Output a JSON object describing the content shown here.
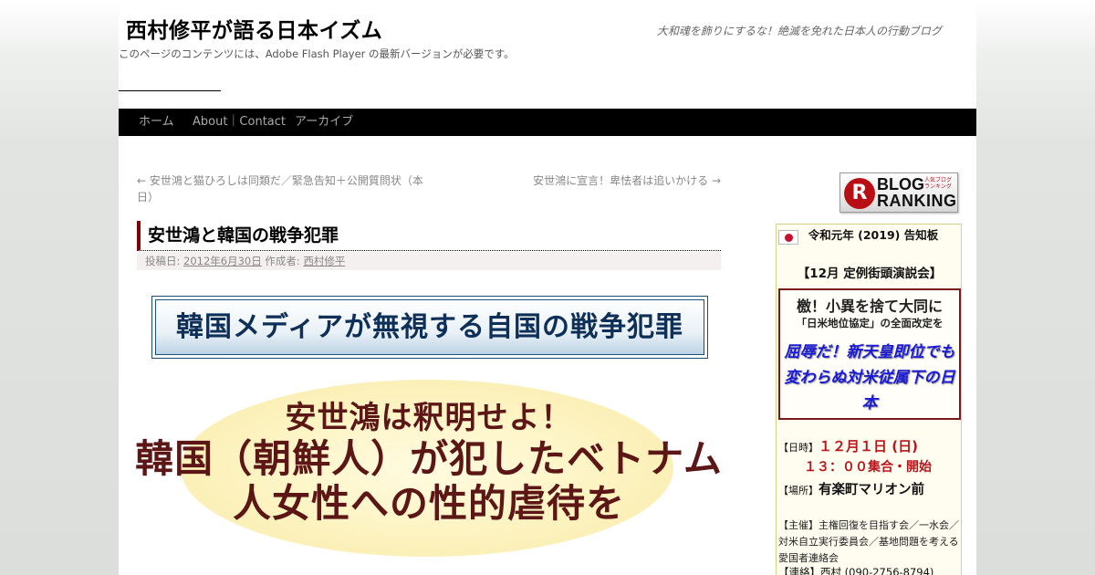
{
  "site": {
    "title": "西村修平が語る日本イズム",
    "description": "大和魂を飾りにするな！絶滅を免れた日本人の行動ブログ",
    "flash_notice": "このページのコンテンツには、Adobe Flash Player の最新バージョンが必要です。"
  },
  "menu": {
    "items": [
      {
        "label": "ホーム"
      },
      {
        "label": "About｜Contact"
      },
      {
        "label": "アーカイブ"
      }
    ]
  },
  "post_nav": {
    "prev": "← 安世鴻と猫ひろしは同類だ／緊急告知＋公開質問状（本日）",
    "next": "安世鴻に宣言！卑怯者は追いかける →"
  },
  "entry": {
    "title": "安世鴻と韓国の戦争犯罪",
    "meta_posted_prefix": "投稿日:",
    "meta_date": "2012年6月30日",
    "meta_author_prefix": "作成者:",
    "meta_author": "西村修平",
    "headline": "韓国メディアが無視する自国の戦争犯罪",
    "demand_line_1": "安世鴻は釈明せよ！",
    "demand_line_2": "韓国（朝鮮人）が犯したベトナム人女性への性的虐待を"
  },
  "sidebar": {
    "ranking_badge": {
      "letter": "R",
      "blog": "BLOG",
      "small": "人気ブログランキング",
      "ranking": "RANKING"
    },
    "notice": {
      "title": "令和元年 (2019) 告知板",
      "speech_title": "【12月 定例街頭演説会】",
      "slogan_1": "檄！小異を捨て大同に",
      "slogan_2": "「日米地位協定」の全面改定を",
      "slogan_3": "屈辱だ！新天皇即位でも変わらぬ対米従属下の日本",
      "date_label": "【日時】",
      "date_value": "１２月１日 (日)",
      "time_value": "１３：００集合・開始",
      "place_label": "【場所】",
      "place_value": "有楽町マリオン前",
      "organizers": "【主催】主権回復を目指す会／一水会／対米自立実行委員会／基地問題を考える愛国者連絡会",
      "contact": "【連絡】西村 (090-2756-8794)"
    }
  }
}
